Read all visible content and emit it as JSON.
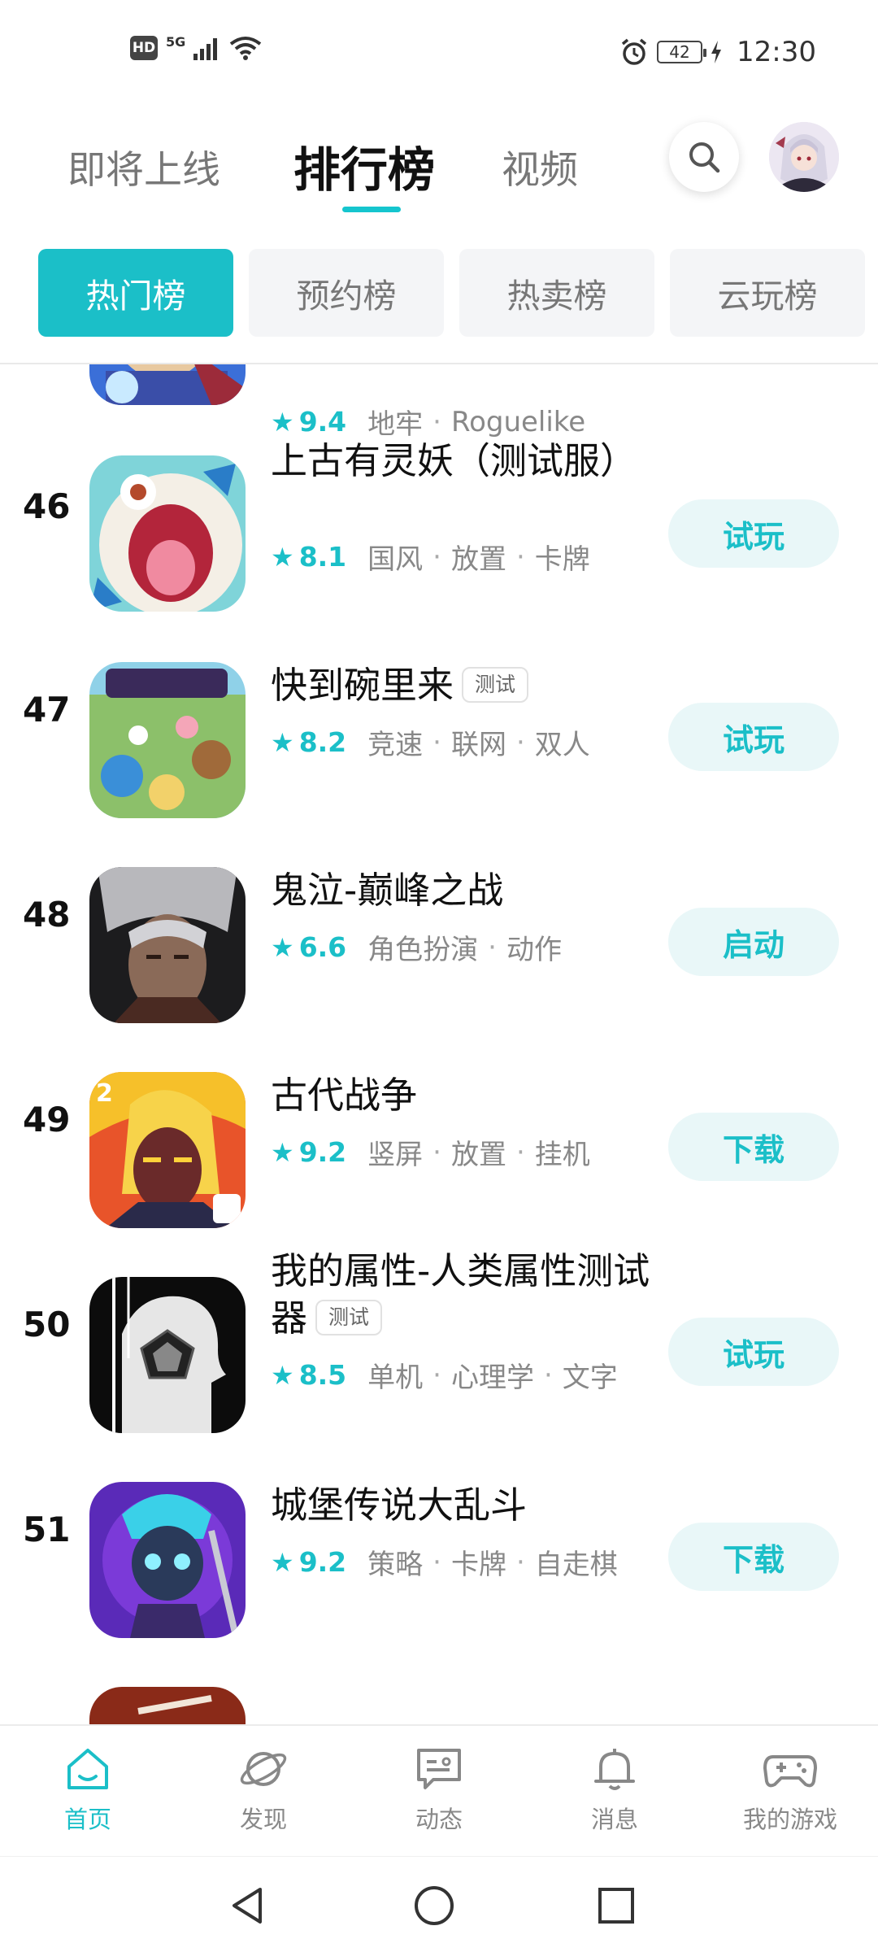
{
  "status_bar": {
    "hd": "HD",
    "network": "5G",
    "battery": "42",
    "time": "12:30"
  },
  "top_tabs": [
    {
      "label": "即将上线",
      "active": false
    },
    {
      "label": "排行榜",
      "active": true
    },
    {
      "label": "视频",
      "active": false
    }
  ],
  "chips": [
    {
      "label": "热门榜",
      "active": true
    },
    {
      "label": "预约榜",
      "active": false
    },
    {
      "label": "热卖榜",
      "active": false
    },
    {
      "label": "云玩榜",
      "active": false
    }
  ],
  "partial_row": {
    "score": "9.4",
    "tags": [
      "地牢",
      "Roguelike"
    ]
  },
  "games": [
    {
      "rank": "46",
      "name": "上古有灵妖（测试服）",
      "test_tag": "",
      "score": "8.1",
      "tags": [
        "国风",
        "放置",
        "卡牌"
      ],
      "action": "试玩"
    },
    {
      "rank": "47",
      "name": "快到碗里来",
      "test_tag": "测试",
      "score": "8.2",
      "tags": [
        "竞速",
        "联网",
        "双人"
      ],
      "action": "试玩"
    },
    {
      "rank": "48",
      "name": "鬼泣-巅峰之战",
      "test_tag": "",
      "score": "6.6",
      "tags": [
        "角色扮演",
        "动作"
      ],
      "action": "启动"
    },
    {
      "rank": "49",
      "name": "古代战争",
      "test_tag": "",
      "score": "9.2",
      "tags": [
        "竖屏",
        "放置",
        "挂机"
      ],
      "action": "下载"
    },
    {
      "rank": "50",
      "name": "我的属性-人类属性测试器",
      "test_tag": "测试",
      "score": "8.5",
      "tags": [
        "单机",
        "心理学",
        "文字"
      ],
      "action": "试玩"
    },
    {
      "rank": "51",
      "name": "城堡传说大乱斗",
      "test_tag": "",
      "score": "9.2",
      "tags": [
        "策略",
        "卡牌",
        "自走棋"
      ],
      "action": "下载"
    }
  ],
  "icons": {
    "search": "search-icon",
    "star": "star-icon",
    "home": "home-icon",
    "discover": "planet-icon",
    "feed": "message-card-icon",
    "messages": "bell-icon",
    "my_games": "gamepad-icon"
  },
  "bottom_nav": [
    {
      "label": "首页",
      "active": true
    },
    {
      "label": "发现",
      "active": false
    },
    {
      "label": "动态",
      "active": false
    },
    {
      "label": "消息",
      "active": false
    },
    {
      "label": "我的游戏",
      "active": false
    }
  ],
  "colors": {
    "accent": "#1bbfc8",
    "button_bg": "#e9f7f8",
    "chip_bg": "#f4f5f7"
  }
}
